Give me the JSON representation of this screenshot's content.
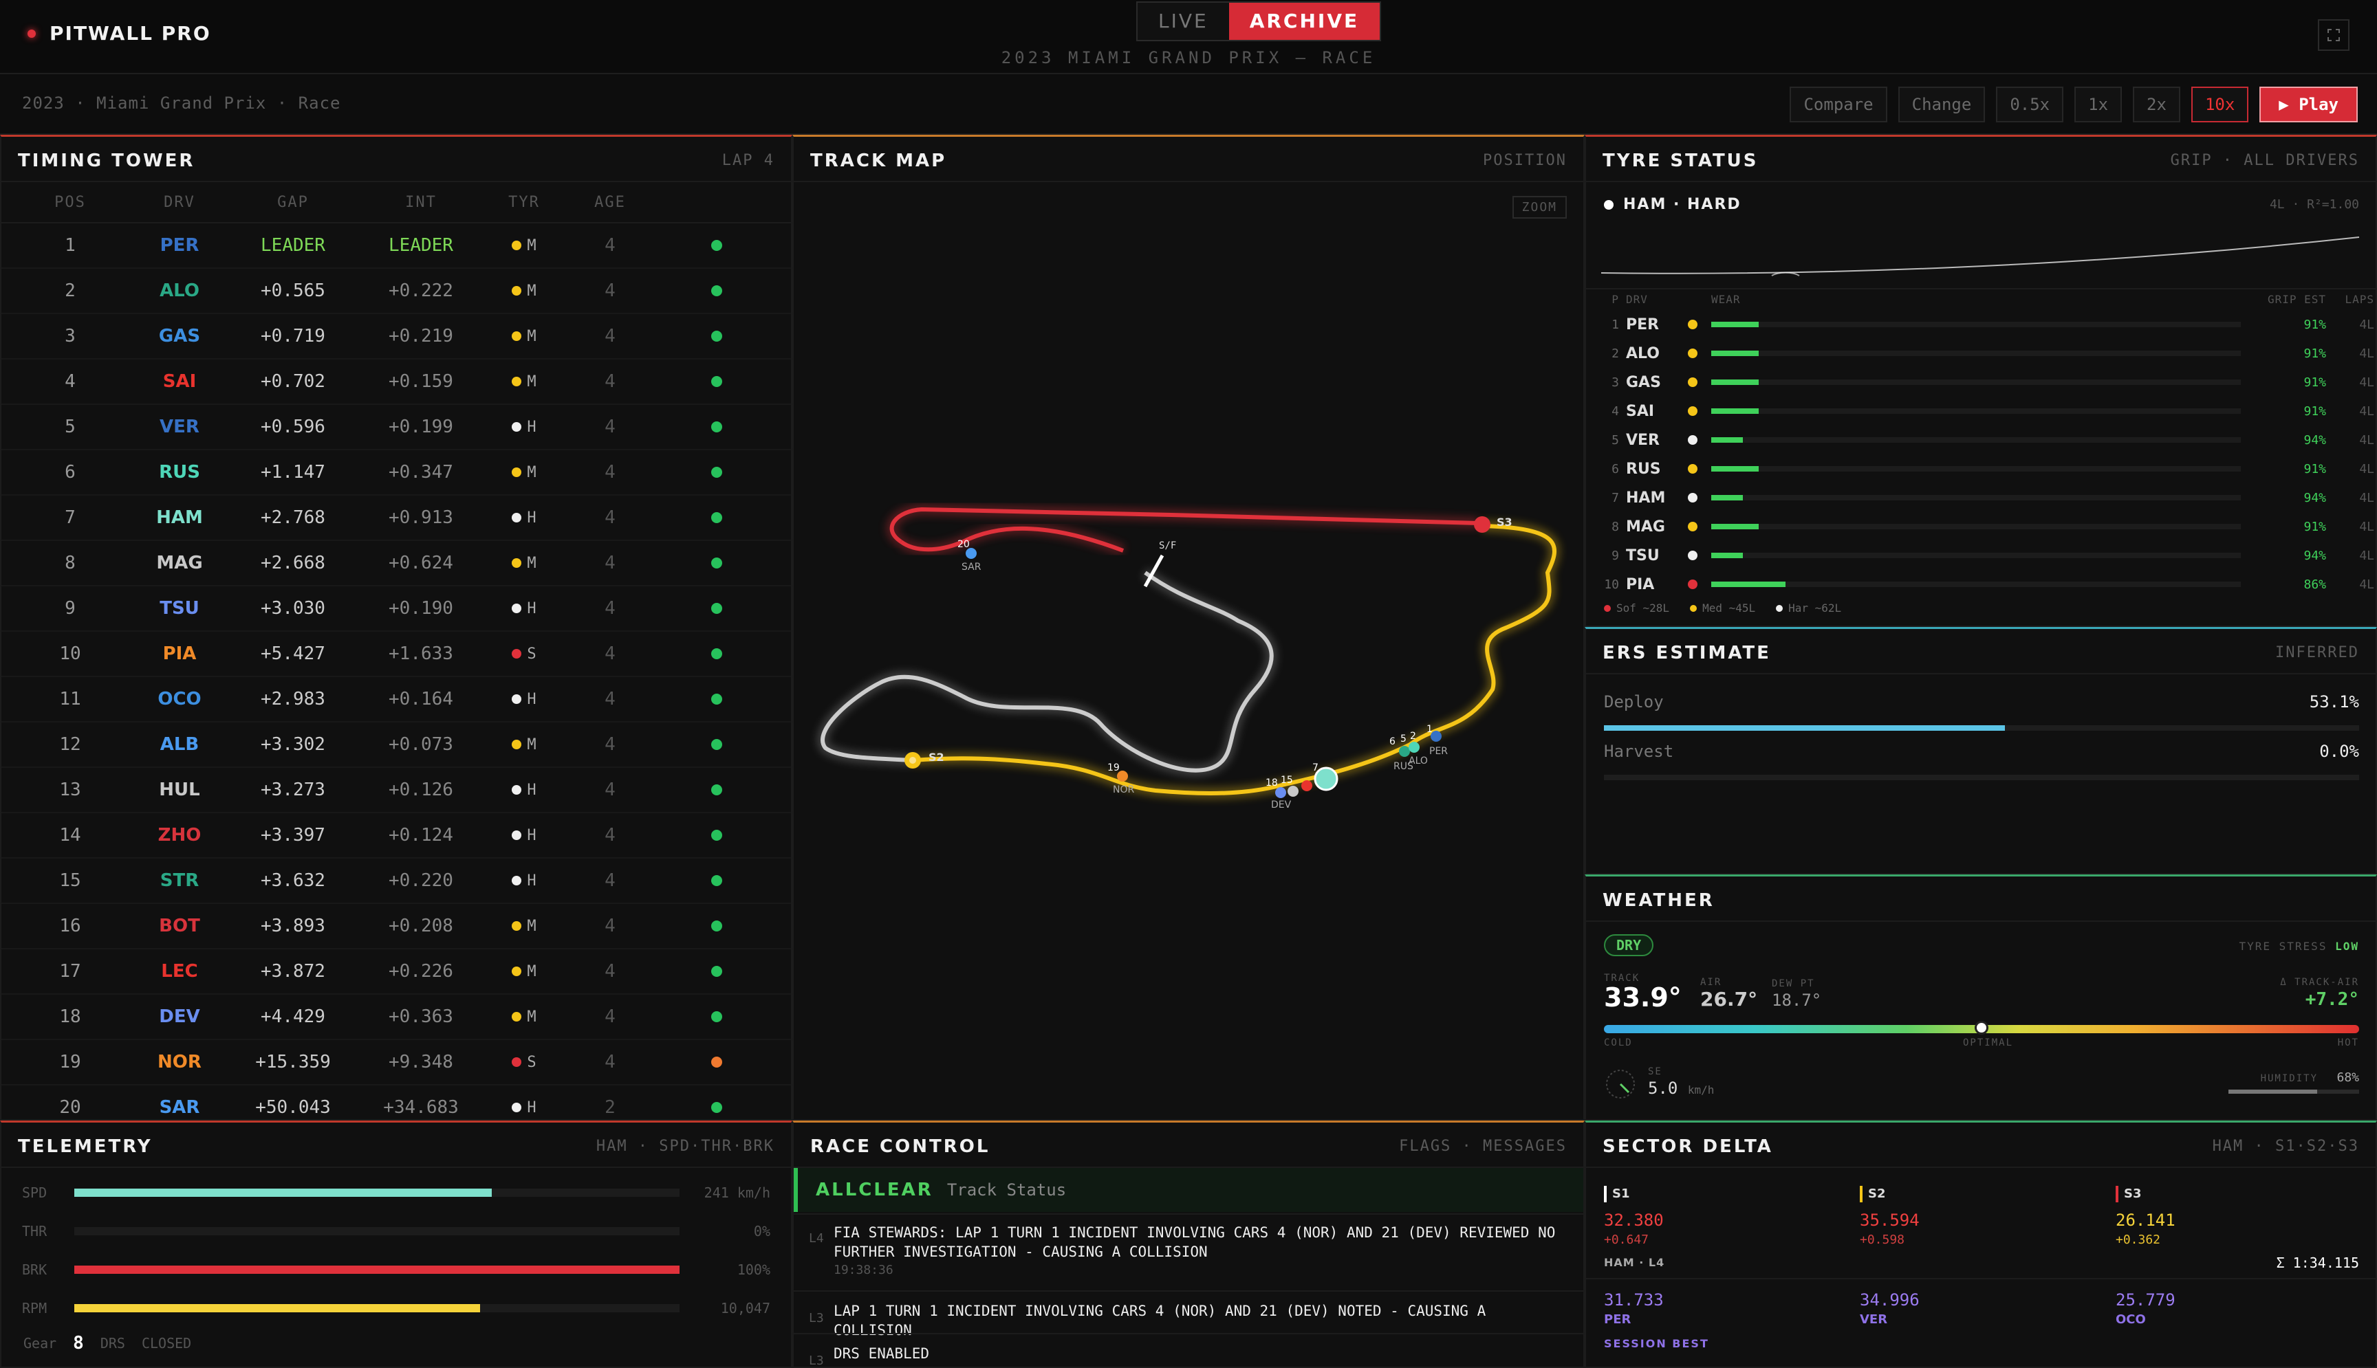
{
  "header": {
    "brand": "PITWALL PRO",
    "modes": [
      "LIVE",
      "ARCHIVE"
    ],
    "active_mode": "ARCHIVE",
    "subtitle": "2023 MIAMI GRAND PRIX — RACE"
  },
  "controls": {
    "breadcrumb": "2023 · Miami Grand Prix · Race",
    "compare": "Compare",
    "change": "Change",
    "speeds": [
      "0.5x",
      "1x",
      "2x",
      "10x"
    ],
    "selected_speed": "10x",
    "play": "▶ Play"
  },
  "timing": {
    "title": "TIMING TOWER",
    "meta": "LAP 4",
    "columns": [
      "POS",
      "DRV",
      "GAP",
      "INT",
      "TYR",
      "AGE"
    ],
    "rows": [
      {
        "pos": "1",
        "drv": "PER",
        "color": "#3671c6",
        "gap": "LEADER",
        "int": "LEADER",
        "tyre": "M",
        "age": "4",
        "status": "#27c25c"
      },
      {
        "pos": "2",
        "drv": "ALO",
        "color": "#2aa886",
        "gap": "+0.565",
        "int": "+0.222",
        "tyre": "M",
        "age": "4",
        "status": "#27c25c"
      },
      {
        "pos": "3",
        "drv": "GAS",
        "color": "#3d8fe0",
        "gap": "+0.719",
        "int": "+0.219",
        "tyre": "M",
        "age": "4",
        "status": "#27c25c"
      },
      {
        "pos": "4",
        "drv": "SAI",
        "color": "#e8332e",
        "gap": "+0.702",
        "int": "+0.159",
        "tyre": "M",
        "age": "4",
        "status": "#27c25c"
      },
      {
        "pos": "5",
        "drv": "VER",
        "color": "#3671c6",
        "gap": "+0.596",
        "int": "+0.199",
        "tyre": "H",
        "age": "4",
        "status": "#27c25c"
      },
      {
        "pos": "6",
        "drv": "RUS",
        "color": "#4ed6b8",
        "gap": "+1.147",
        "int": "+0.347",
        "tyre": "M",
        "age": "4",
        "status": "#27c25c"
      },
      {
        "pos": "7",
        "drv": "HAM",
        "color": "#7ee0cc",
        "gap": "+2.768",
        "int": "+0.913",
        "tyre": "H",
        "age": "4",
        "status": "#27c25c"
      },
      {
        "pos": "8",
        "drv": "MAG",
        "color": "#c8c8c8",
        "gap": "+2.668",
        "int": "+0.624",
        "tyre": "M",
        "age": "4",
        "status": "#27c25c"
      },
      {
        "pos": "9",
        "drv": "TSU",
        "color": "#6a8ef0",
        "gap": "+3.030",
        "int": "+0.190",
        "tyre": "H",
        "age": "4",
        "status": "#27c25c"
      },
      {
        "pos": "10",
        "drv": "PIA",
        "color": "#f08a28",
        "gap": "+5.427",
        "int": "+1.633",
        "tyre": "S",
        "age": "4",
        "status": "#27c25c"
      },
      {
        "pos": "11",
        "drv": "OCO",
        "color": "#3d8fe0",
        "gap": "+2.983",
        "int": "+0.164",
        "tyre": "H",
        "age": "4",
        "status": "#27c25c"
      },
      {
        "pos": "12",
        "drv": "ALB",
        "color": "#4a9af0",
        "gap": "+3.302",
        "int": "+0.073",
        "tyre": "M",
        "age": "4",
        "status": "#27c25c"
      },
      {
        "pos": "13",
        "drv": "HUL",
        "color": "#c8c8c8",
        "gap": "+3.273",
        "int": "+0.126",
        "tyre": "H",
        "age": "4",
        "status": "#27c25c"
      },
      {
        "pos": "14",
        "drv": "ZHO",
        "color": "#d8343c",
        "gap": "+3.397",
        "int": "+0.124",
        "tyre": "H",
        "age": "4",
        "status": "#27c25c"
      },
      {
        "pos": "15",
        "drv": "STR",
        "color": "#2aa886",
        "gap": "+3.632",
        "int": "+0.220",
        "tyre": "H",
        "age": "4",
        "status": "#27c25c"
      },
      {
        "pos": "16",
        "drv": "BOT",
        "color": "#d8343c",
        "gap": "+3.893",
        "int": "+0.208",
        "tyre": "M",
        "age": "4",
        "status": "#27c25c"
      },
      {
        "pos": "17",
        "drv": "LEC",
        "color": "#e8332e",
        "gap": "+3.872",
        "int": "+0.226",
        "tyre": "M",
        "age": "4",
        "status": "#27c25c"
      },
      {
        "pos": "18",
        "drv": "DEV",
        "color": "#6a8ef0",
        "gap": "+4.429",
        "int": "+0.363",
        "tyre": "M",
        "age": "4",
        "status": "#27c25c"
      },
      {
        "pos": "19",
        "drv": "NOR",
        "color": "#f08a28",
        "gap": "+15.359",
        "int": "+9.348",
        "tyre": "S",
        "age": "4",
        "status": "#f07a30"
      },
      {
        "pos": "20",
        "drv": "SAR",
        "color": "#4a9af0",
        "gap": "+50.043",
        "int": "+34.683",
        "tyre": "H",
        "age": "2",
        "status": "#27c25c"
      }
    ]
  },
  "tyre_colors": {
    "S": "#e0313b",
    "M": "#f5c518",
    "H": "#f0f0f0"
  },
  "trackmap": {
    "title": "TRACK MAP",
    "meta": "POSITION",
    "zoom": "ZOOM",
    "sf_label": "S/F",
    "sector_labels": [
      "S2",
      "S3"
    ],
    "car_labels": [
      "20",
      "SAR",
      "19",
      "NOR",
      "18",
      "15",
      "7",
      "6",
      "5",
      "2",
      "1",
      "PER",
      "DEV",
      "RUS",
      "ALO"
    ]
  },
  "tyres": {
    "title": "TYRE STATUS",
    "meta": "GRIP · ALL DRIVERS",
    "selected": "HAM · HARD",
    "fit": "4L · R²=1.00",
    "columns": [
      "P",
      "DRV",
      "WEAR",
      "GRIP EST",
      "LAPS"
    ],
    "rows": [
      {
        "p": "1",
        "drv": "PER",
        "tyre": "M",
        "wear": 0.09,
        "grip": "91%",
        "laps": "4L"
      },
      {
        "p": "2",
        "drv": "ALO",
        "tyre": "M",
        "wear": 0.09,
        "grip": "91%",
        "laps": "4L"
      },
      {
        "p": "3",
        "drv": "GAS",
        "tyre": "M",
        "wear": 0.09,
        "grip": "91%",
        "laps": "4L"
      },
      {
        "p": "4",
        "drv": "SAI",
        "tyre": "M",
        "wear": 0.09,
        "grip": "91%",
        "laps": "4L"
      },
      {
        "p": "5",
        "drv": "VER",
        "tyre": "H",
        "wear": 0.06,
        "grip": "94%",
        "laps": "4L"
      },
      {
        "p": "6",
        "drv": "RUS",
        "tyre": "M",
        "wear": 0.09,
        "grip": "91%",
        "laps": "4L"
      },
      {
        "p": "7",
        "drv": "HAM",
        "tyre": "H",
        "wear": 0.06,
        "grip": "94%",
        "laps": "4L"
      },
      {
        "p": "8",
        "drv": "MAG",
        "tyre": "M",
        "wear": 0.09,
        "grip": "91%",
        "laps": "4L"
      },
      {
        "p": "9",
        "drv": "TSU",
        "tyre": "H",
        "wear": 0.06,
        "grip": "94%",
        "laps": "4L"
      },
      {
        "p": "10",
        "drv": "PIA",
        "tyre": "S",
        "wear": 0.14,
        "grip": "86%",
        "laps": "4L"
      }
    ],
    "legend": [
      "Sof ~28L",
      "Med ~45L",
      "Har ~62L"
    ]
  },
  "ers": {
    "title": "ERS ESTIMATE",
    "meta": "INFERRED",
    "deploy_label": "Deploy",
    "deploy_value": "53.1%",
    "deploy": 0.531,
    "harvest_label": "Harvest",
    "harvest_value": "0.0%",
    "harvest": 0.0
  },
  "weather": {
    "title": "WEATHER",
    "condition": "DRY",
    "stress_label": "TYRE STRESS",
    "stress": "LOW",
    "track_label": "TRACK",
    "track": "33.9°",
    "air_label": "AIR",
    "air": "26.7°",
    "dew_label": "DEW PT",
    "dew": "18.7°",
    "delta_label": "Δ TRACK-AIR",
    "delta": "+7.2°",
    "scale": [
      "COLD",
      "OPTIMAL",
      "HOT"
    ],
    "scale_position": 0.5,
    "wind_dir": "SE",
    "wind_speed": "5.0",
    "wind_unit": "km/h",
    "humidity_label": "HUMIDITY",
    "humidity": "68%",
    "humidity_value": 0.68
  },
  "telemetry": {
    "title": "TELEMETRY",
    "meta": "HAM · SPD·THR·BRK",
    "rows": [
      {
        "key": "SPD",
        "value": "241 km/h",
        "fraction": 0.69,
        "color": "#7ee0cc"
      },
      {
        "key": "THR",
        "value": "0%",
        "fraction": 0.0,
        "color": "#3fd15a"
      },
      {
        "key": "BRK",
        "value": "100%",
        "fraction": 1.0,
        "color": "#e0313b"
      },
      {
        "key": "RPM",
        "value": "10,047",
        "fraction": 0.67,
        "color": "#f5d33a"
      }
    ],
    "gear_label": "Gear",
    "gear": "8",
    "drs_label": "DRS",
    "drs": "CLOSED"
  },
  "race_control": {
    "title": "RACE CONTROL",
    "meta": "FLAGS · MESSAGES",
    "status_flag": "ALLCLEAR",
    "status_text": "Track Status",
    "messages": [
      {
        "lap": "L4",
        "text": "FIA STEWARDS: LAP 1 TURN 1 INCIDENT INVOLVING CARS 4 (NOR) AND 21 (DEV) REVIEWED NO FURTHER INVESTIGATION - CAUSING A COLLISION",
        "time": "19:38:36"
      },
      {
        "lap": "L3",
        "text": "LAP 1 TURN 1 INCIDENT INVOLVING CARS 4 (NOR) AND 21 (DEV) NOTED - CAUSING A COLLISION",
        "time": ""
      },
      {
        "lap": "L3",
        "text": "DRS ENABLED",
        "time": ""
      }
    ]
  },
  "sector": {
    "title": "SECTOR DELTA",
    "meta": "HAM · S1·S2·S3",
    "driver_lap": "HAM · L4",
    "total": "Σ 1:34.115",
    "best_label": "SESSION BEST",
    "sectors": [
      {
        "name": "S1",
        "color": "#ffffff",
        "time": "32.380",
        "delta": "+0.647",
        "time_color": "#f04040",
        "delta_color": "#d04040",
        "best": "31.733",
        "best_drv": "PER"
      },
      {
        "name": "S2",
        "color": "#f5c518",
        "time": "35.594",
        "delta": "+0.598",
        "time_color": "#f04040",
        "delta_color": "#d04040",
        "best": "34.996",
        "best_drv": "VER"
      },
      {
        "name": "S3",
        "color": "#e0313b",
        "time": "26.141",
        "delta": "+0.362",
        "time_color": "#f5d33a",
        "delta_color": "#e8c030",
        "best": "25.779",
        "best_drv": "OCO"
      }
    ]
  }
}
